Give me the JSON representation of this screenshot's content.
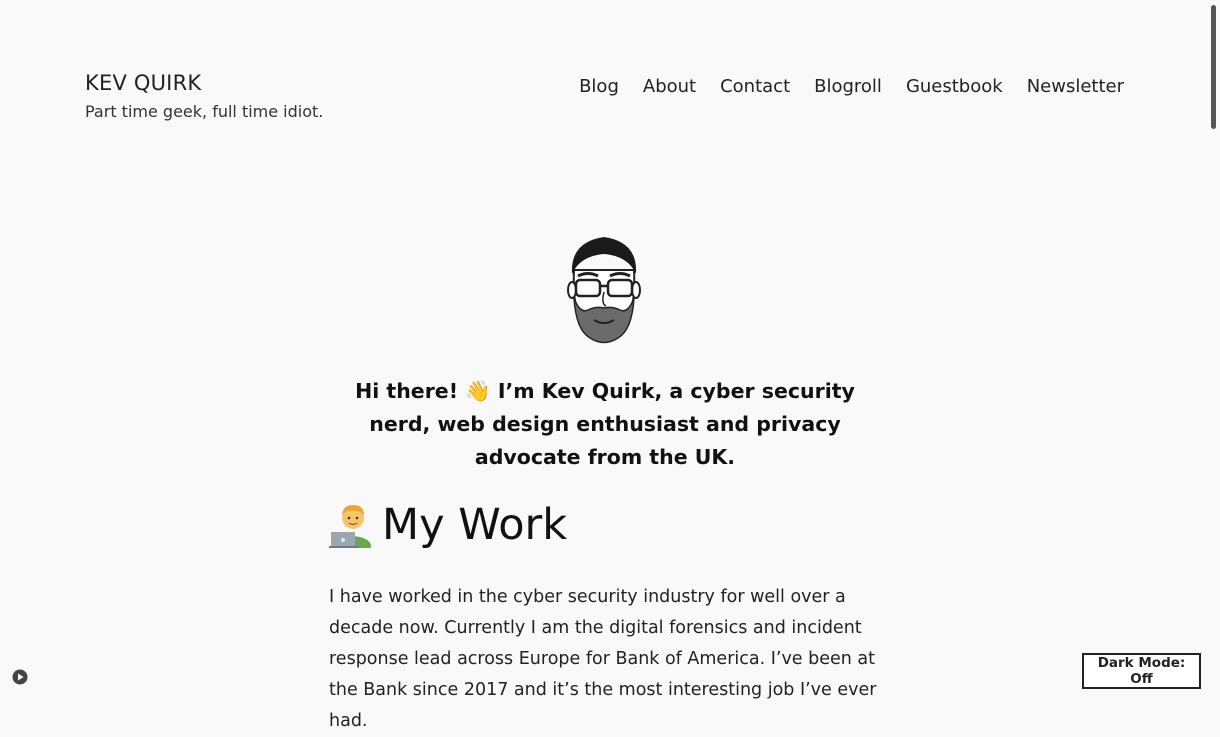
{
  "site": {
    "title": "KEV QUIRK",
    "tagline": "Part time geek, full time idiot."
  },
  "nav": {
    "items": [
      {
        "label": "Blog"
      },
      {
        "label": "About"
      },
      {
        "label": "Contact"
      },
      {
        "label": "Blogroll"
      },
      {
        "label": "Guestbook"
      },
      {
        "label": "Newsletter"
      }
    ]
  },
  "intro": {
    "greeting": "Hi there!",
    "wave_icon": "👋",
    "text": "I’m Kev Quirk, a cyber security nerd, web design enthusiast and privacy advocate from the UK."
  },
  "work": {
    "heading": "My Work",
    "icon": "man-technologist-icon",
    "paragraph": "I have worked in the cyber security industry for well over a decade now. Currently I am the digital forensics and incident response lead across Europe for Bank of America. I’ve been at the Bank since 2017 and it’s the most interesting job I’ve ever had."
  },
  "dark_mode": {
    "label": "Dark Mode: Off"
  }
}
